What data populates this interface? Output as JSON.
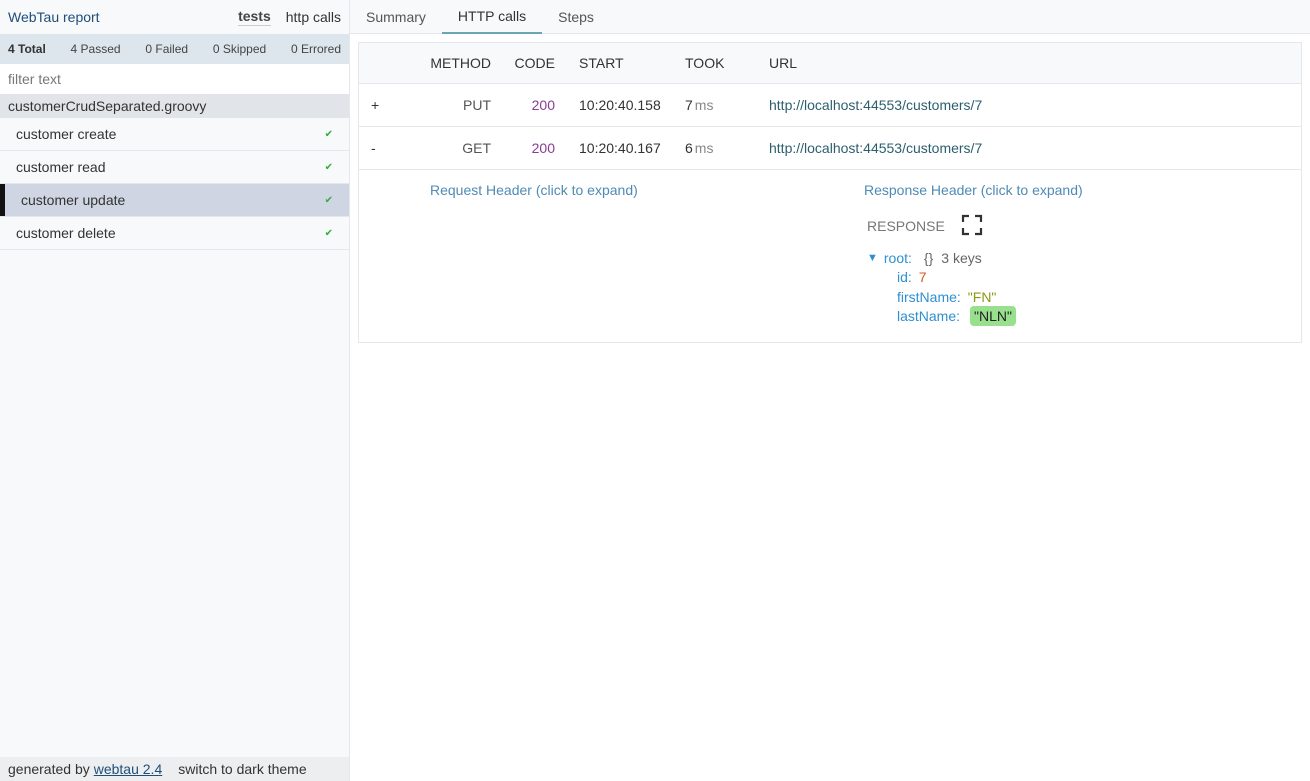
{
  "app": {
    "title": "WebTau report",
    "mode_tabs": [
      {
        "label": "tests",
        "active": true
      },
      {
        "label": "http calls",
        "active": false
      }
    ]
  },
  "stats": {
    "total": "4 Total",
    "passed": "4 Passed",
    "failed": "0 Failed",
    "skipped": "0 Skipped",
    "errored": "0 Errored"
  },
  "filter": {
    "placeholder": "filter text",
    "value": ""
  },
  "file_group": "customerCrudSeparated.groovy",
  "tests": [
    {
      "label": "customer create",
      "status": "passed",
      "selected": false
    },
    {
      "label": "customer read",
      "status": "passed",
      "selected": false
    },
    {
      "label": "customer update",
      "status": "passed",
      "selected": true
    },
    {
      "label": "customer delete",
      "status": "passed",
      "selected": false
    }
  ],
  "check_glyph": "✔",
  "footer": {
    "generated_by": "generated by",
    "link": "webtau 2.4",
    "theme_switch": "switch to dark theme"
  },
  "tabs": [
    {
      "label": "Summary",
      "active": false
    },
    {
      "label": "HTTP calls",
      "active": true
    },
    {
      "label": "Steps",
      "active": false
    }
  ],
  "calls_table": {
    "headers": {
      "method": "METHOD",
      "code": "CODE",
      "start": "START",
      "took": "TOOK",
      "url": "URL"
    },
    "rows": [
      {
        "toggle": "+",
        "method": "PUT",
        "code": "200",
        "start": "10:20:40.158",
        "took": "7",
        "took_unit": "ms",
        "url": "http://localhost:44553/customers/7",
        "expanded": false
      },
      {
        "toggle": "-",
        "method": "GET",
        "code": "200",
        "start": "10:20:40.167",
        "took": "6",
        "took_unit": "ms",
        "url": "http://localhost:44553/customers/7",
        "expanded": true
      }
    ]
  },
  "details": {
    "request_header": "Request Header (click to expand)",
    "response_header": "Response Header (click to expand)",
    "response_label": "RESPONSE",
    "json": {
      "root_key": "root:",
      "root_brace": "{}",
      "root_count": "3 keys",
      "fields": [
        {
          "key": "id:",
          "value": "7",
          "type": "number",
          "changed": false
        },
        {
          "key": "firstName:",
          "value": "\"FN\"",
          "type": "string",
          "changed": false
        },
        {
          "key": "lastName:",
          "value": "\"NLN\"",
          "type": "string",
          "changed": true
        }
      ]
    }
  },
  "colors": {
    "accent_tab": "#6aa5b5",
    "status_code": "#8a3c94",
    "json_key": "#2f8fcf",
    "json_number": "#d35a1a",
    "json_string": "#8a9a12",
    "changed_highlight": "#98e08e",
    "pass_check": "#2fae3a"
  }
}
